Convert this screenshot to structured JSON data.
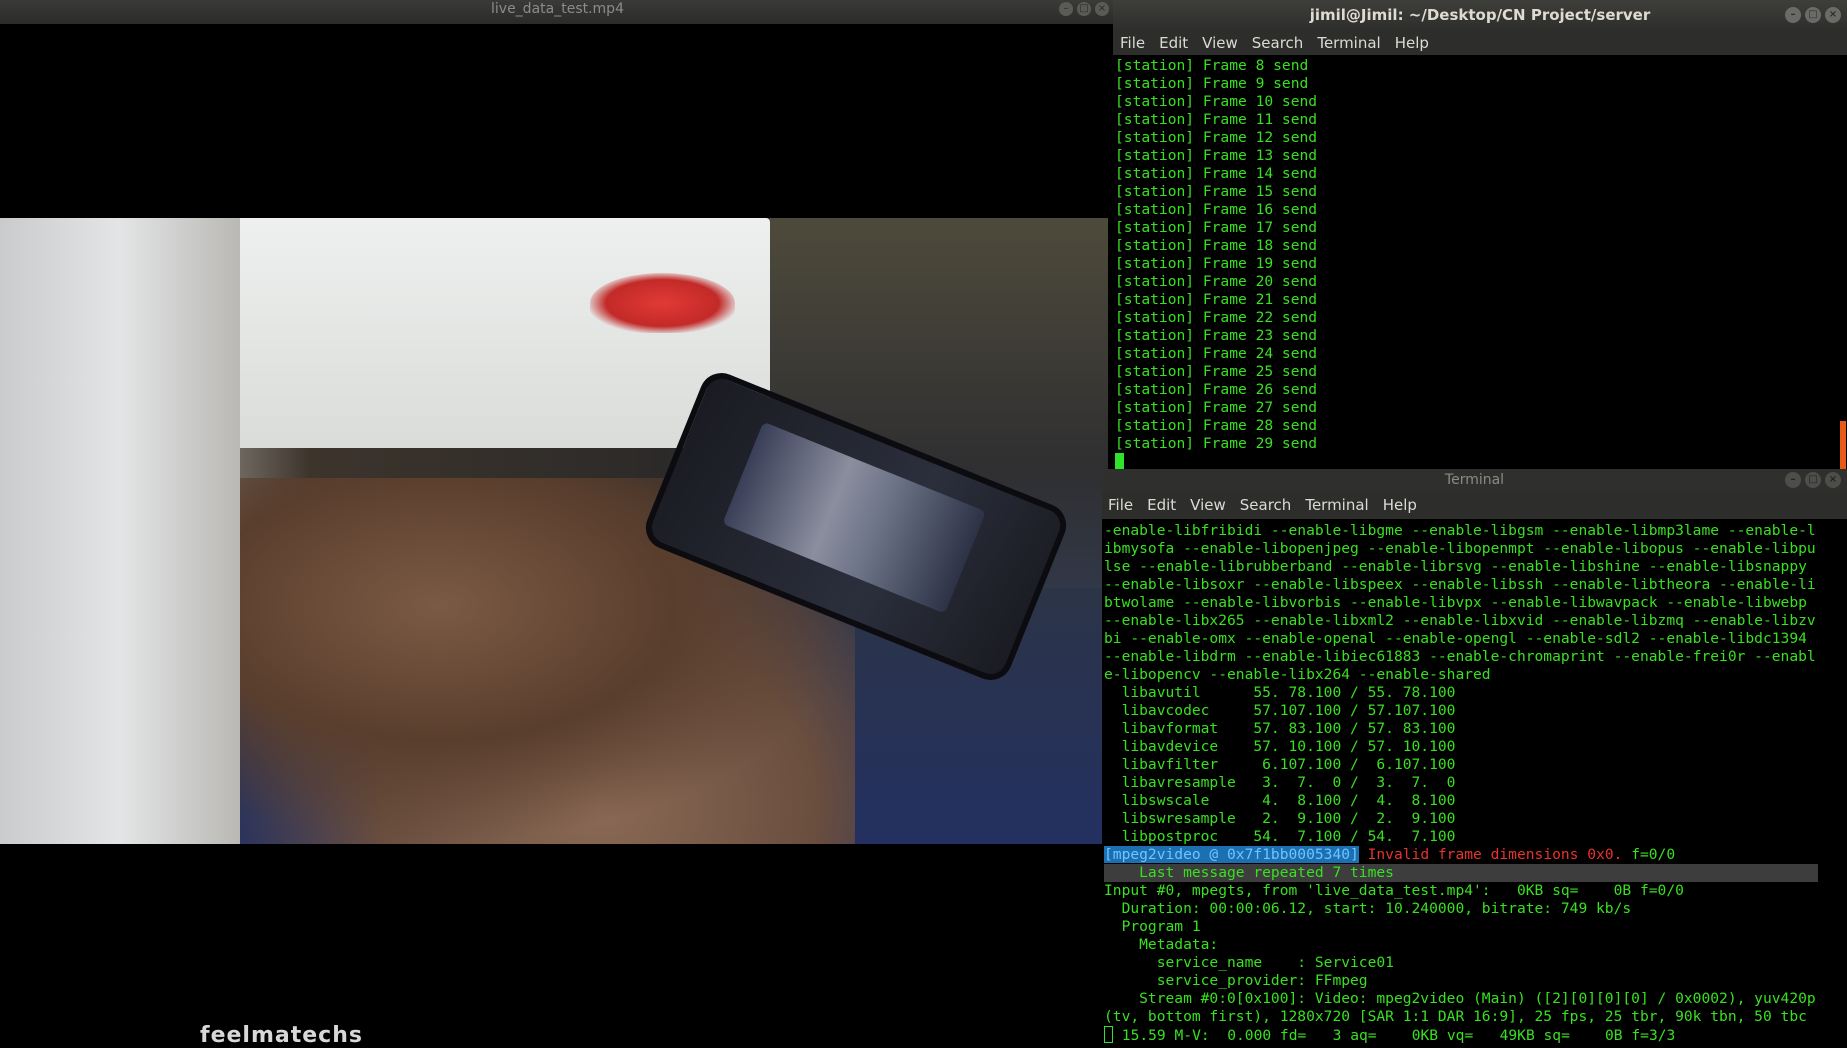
{
  "video_player": {
    "title": "live_data_test.mp4",
    "bottom_text": "feelmatechs"
  },
  "terminal_top": {
    "title": "jimil@Jimil: ~/Desktop/CN Project/server",
    "menu": [
      "File",
      "Edit",
      "View",
      "Search",
      "Terminal",
      "Help"
    ],
    "lines": [
      "[station] Frame 8 send",
      "[station] Frame 9 send",
      "[station] Frame 10 send",
      "[station] Frame 11 send",
      "[station] Frame 12 send",
      "[station] Frame 13 send",
      "[station] Frame 14 send",
      "[station] Frame 15 send",
      "[station] Frame 16 send",
      "[station] Frame 17 send",
      "[station] Frame 18 send",
      "[station] Frame 19 send",
      "[station] Frame 20 send",
      "[station] Frame 21 send",
      "[station] Frame 22 send",
      "[station] Frame 23 send",
      "[station] Frame 24 send",
      "[station] Frame 25 send",
      "[station] Frame 26 send",
      "[station] Frame 27 send",
      "[station] Frame 28 send",
      "[station] Frame 29 send"
    ]
  },
  "terminal_bottom": {
    "title": "Terminal",
    "menu": [
      "File",
      "Edit",
      "View",
      "Search",
      "Terminal",
      "Help"
    ],
    "config_lines": [
      "-enable-libfribidi --enable-libgme --enable-libgsm --enable-libmp3lame --enable-l",
      "ibmysofa --enable-libopenjpeg --enable-libopenmpt --enable-libopus --enable-libpu",
      "lse --enable-librubberband --enable-librsvg --enable-libshine --enable-libsnappy",
      "--enable-libsoxr --enable-libspeex --enable-libssh --enable-libtheora --enable-li",
      "btwolame --enable-libvorbis --enable-libvpx --enable-libwavpack --enable-libwebp",
      "--enable-libx265 --enable-libxml2 --enable-libxvid --enable-libzmq --enable-libzv",
      "bi --enable-omx --enable-openal --enable-opengl --enable-sdl2 --enable-libdc1394",
      "--enable-libdrm --enable-libiec61883 --enable-chromaprint --enable-frei0r --enabl",
      "e-libopencv --enable-libx264 --enable-shared"
    ],
    "lib_lines": [
      "  libavutil      55. 78.100 / 55. 78.100",
      "  libavcodec     57.107.100 / 57.107.100",
      "  libavformat    57. 83.100 / 57. 83.100",
      "  libavdevice    57. 10.100 / 57. 10.100",
      "  libavfilter     6.107.100 /  6.107.100",
      "  libavresample   3.  7.  0 /  3.  7.  0",
      "  libswscale      4.  8.100 /  4.  8.100",
      "  libswresample   2.  9.100 /  2.  9.100",
      "  libpostproc    54.  7.100 / 54.  7.100"
    ],
    "error_tag": "[mpeg2video @ 0x7f1bb0005340]",
    "error_msg": " Invalid frame dimensions 0x0.",
    "error_tail": " f=0/0",
    "repeat_line": "    Last message repeated 7 times",
    "info_lines": [
      "Input #0, mpegts, from 'live_data_test.mp4':   0KB sq=    0B f=0/0",
      "  Duration: 00:00:06.12, start: 10.240000, bitrate: 749 kb/s",
      "  Program 1",
      "    Metadata:",
      "      service_name    : Service01",
      "      service_provider: FFmpeg",
      "    Stream #0:0[0x100]: Video: mpeg2video (Main) ([2][0][0][0] / 0x0002), yuv420p",
      "(tv, bottom first), 1280x720 [SAR 1:1 DAR 16:9], 25 fps, 25 tbr, 90k tbn, 50 tbc"
    ],
    "status_line": " 15.59 M-V:  0.000 fd=   3 aq=    0KB vq=   49KB sq=    0B f=3/3"
  }
}
